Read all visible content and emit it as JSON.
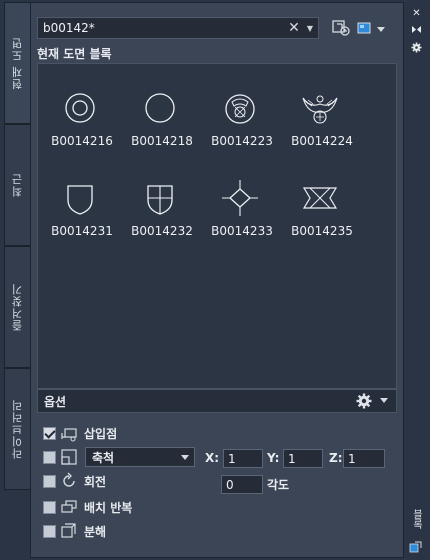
{
  "left_tabs": [
    {
      "label": "현재 도면",
      "active": true
    },
    {
      "label": "최근",
      "active": false
    },
    {
      "label": "즐겨찾기",
      "active": false
    },
    {
      "label": "라이브러리",
      "active": false
    }
  ],
  "search": {
    "value": "b00142*",
    "clear_icon": "close-icon",
    "dropdown_icon": "chevron-down-icon"
  },
  "toolbar": {
    "import_icon": "load-block-icon",
    "view_icon": "thumbnail-view-icon"
  },
  "section_title": "현재 도면 블록",
  "blocks": [
    {
      "name": "B0014216",
      "icon": "concentric-circle-symbol"
    },
    {
      "name": "B0014218",
      "icon": "circle-symbol"
    },
    {
      "name": "B0014223",
      "icon": "emblem-circle-symbol"
    },
    {
      "name": "B0014224",
      "icon": "eagle-emblem-symbol"
    },
    {
      "name": "B0014231",
      "icon": "shield-symbol"
    },
    {
      "name": "B0014232",
      "icon": "cross-shield-symbol"
    },
    {
      "name": "B0014233",
      "icon": "diamond-symbol"
    },
    {
      "name": "B0014235",
      "icon": "ribbon-symbol"
    }
  ],
  "options": {
    "title": "옵션",
    "insertion_point": {
      "label": "삽입점",
      "checked": true
    },
    "scale": {
      "label": "축척",
      "checked": false,
      "x_label": "X:",
      "x": "1",
      "y_label": "Y:",
      "y": "1",
      "z_label": "Z:",
      "z": "1"
    },
    "rotation": {
      "label": "회전",
      "checked": false,
      "angle": "0",
      "angle_label": "각도"
    },
    "repeat": {
      "label": "배치 반복",
      "checked": false
    },
    "explode": {
      "label": "분해",
      "checked": false
    }
  },
  "right_strip": {
    "close_icon": "close-icon",
    "autohide_icon": "auto-hide-icon",
    "properties_icon": "gear-icon",
    "palette_label": "블록"
  },
  "colors": {
    "panel": "#3b4556",
    "background": "#2b3444",
    "content": "#2c3544",
    "accent_blue": "#2f8bd8"
  }
}
